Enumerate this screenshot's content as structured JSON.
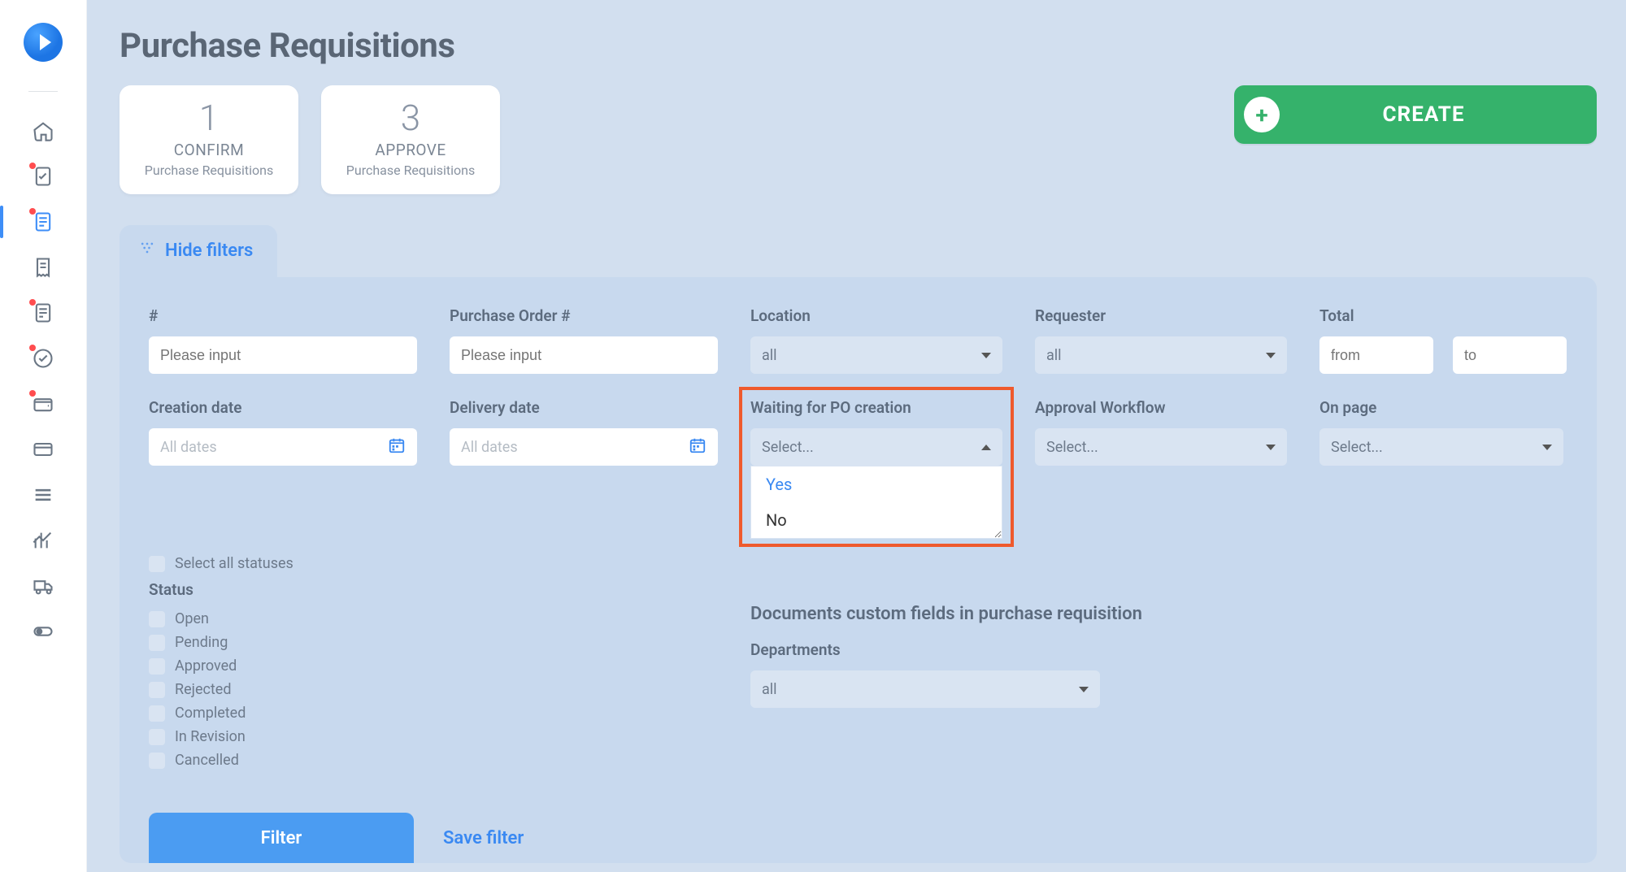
{
  "page_title": "Purchase Requisitions",
  "stats": [
    {
      "count": "1",
      "label": "CONFIRM",
      "sub": "Purchase Requisitions"
    },
    {
      "count": "3",
      "label": "APPROVE",
      "sub": "Purchase Requisitions"
    }
  ],
  "create_label": "CREATE",
  "hide_filters_label": "Hide filters",
  "filters": {
    "number": {
      "label": "#",
      "placeholder": "Please input"
    },
    "po_number": {
      "label": "Purchase Order #",
      "placeholder": "Please input"
    },
    "location": {
      "label": "Location",
      "value": "all"
    },
    "requester": {
      "label": "Requester",
      "value": "all"
    },
    "total": {
      "label": "Total",
      "from_ph": "from",
      "to_ph": "to"
    },
    "creation_date": {
      "label": "Creation date",
      "placeholder": "All dates"
    },
    "delivery_date": {
      "label": "Delivery date",
      "placeholder": "All dates"
    },
    "waiting_po": {
      "label": "Waiting for PO creation",
      "placeholder": "Select...",
      "options": [
        "Yes",
        "No"
      ]
    },
    "approval_workflow": {
      "label": "Approval Workflow",
      "placeholder": "Select..."
    },
    "on_page": {
      "label": "On page",
      "placeholder": "Select..."
    },
    "select_all_statuses": "Select all statuses",
    "status_label": "Status",
    "statuses": [
      "Open",
      "Pending",
      "Approved",
      "Rejected",
      "Completed",
      "In Revision",
      "Cancelled"
    ],
    "custom_fields_title": "Documents custom fields in purchase requisition",
    "departments_label": "Departments",
    "departments_value": "all"
  },
  "actions": {
    "filter": "Filter",
    "save_filter": "Save filter"
  }
}
